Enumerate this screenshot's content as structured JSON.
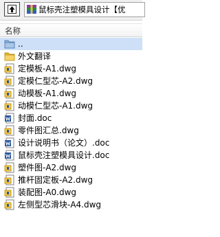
{
  "toolbar": {
    "up_icon": "up-folder-icon",
    "path_icon": "rar-archive-icon",
    "path": "鼠标壳注塑模具设计【优"
  },
  "header": {
    "name_column": "名称"
  },
  "files": [
    {
      "name": "..",
      "icon": "parent-folder-icon",
      "selected": true
    },
    {
      "name": "外文翻译",
      "icon": "folder-icon"
    },
    {
      "name": "定模板-A1.dwg",
      "icon": "dwg-file-icon"
    },
    {
      "name": "定模仁型芯-A2.dwg",
      "icon": "dwg-file-icon"
    },
    {
      "name": "动模板-A1.dwg",
      "icon": "dwg-file-icon"
    },
    {
      "name": "动模仁型芯-A1.dwg",
      "icon": "dwg-file-icon"
    },
    {
      "name": "封面.doc",
      "icon": "doc-file-icon"
    },
    {
      "name": "零件图汇总.dwg",
      "icon": "dwg-file-icon"
    },
    {
      "name": "设计说明书（论文）.doc",
      "icon": "doc-file-icon"
    },
    {
      "name": "鼠标壳注塑模具设计.doc",
      "icon": "doc-file-icon"
    },
    {
      "name": "塑件图-A2.dwg",
      "icon": "dwg-file-icon"
    },
    {
      "name": "推杆固定板-A2.dwg",
      "icon": "dwg-file-icon"
    },
    {
      "name": "装配图-A0.dwg",
      "icon": "dwg-file-icon"
    },
    {
      "name": "左侧型芯滑块-A4.dwg",
      "icon": "dwg-file-icon"
    }
  ],
  "colors": {
    "selection": "#cde0f7",
    "folder": "#f2c94c",
    "doc_blue": "#2b579a"
  }
}
